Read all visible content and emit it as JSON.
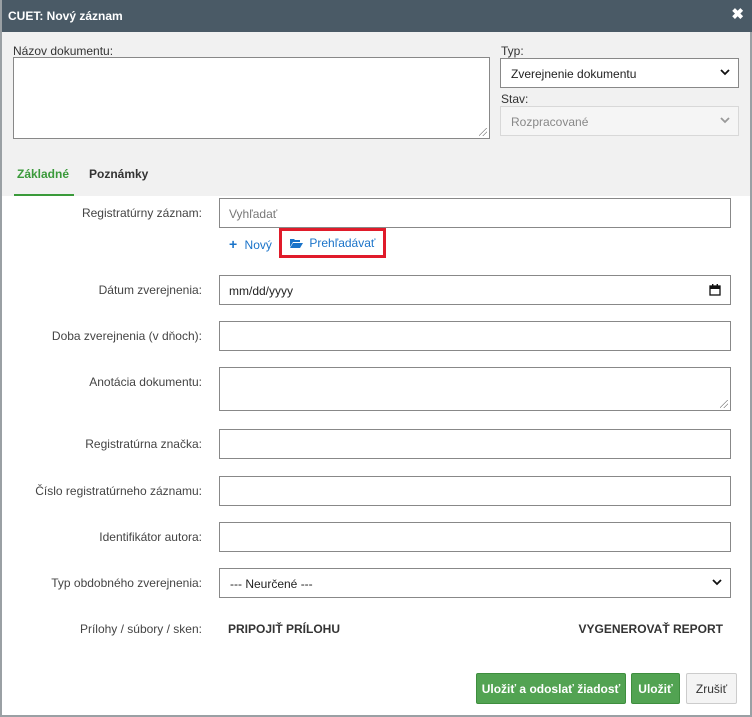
{
  "window": {
    "title": "CUET: Nový záznam",
    "close_icon": "close-icon"
  },
  "header": {
    "name_label": "Názov dokumentu:",
    "name_value": "",
    "type_label": "Typ:",
    "type_value": "Zverejnenie dokumentu",
    "state_label": "Stav:",
    "state_value": "Rozpracované"
  },
  "tabs": [
    {
      "label": "Základné",
      "active": true
    },
    {
      "label": "Poznámky",
      "active": false
    }
  ],
  "form": {
    "registry_label": "Registratúrny záznam:",
    "registry_placeholder": "Vyhľadať",
    "new_link": "Nový",
    "browse_link": "Prehľadávať",
    "date_label": "Dátum zverejnenia:",
    "date_value": "mm/dd/yyyy",
    "duration_label": "Doba zverejnenia (v dňoch):",
    "annotation_label": "Anotácia dokumentu:",
    "mark_label": "Registratúrna značka:",
    "number_label": "Číslo registratúrneho záznamu:",
    "author_label": "Identifikátor autora:",
    "pubtype_label": "Typ obdobného zverejnenia:",
    "pubtype_value": "--- Neurčené ---",
    "attachments_label": "Prílohy / súbory / sken:",
    "attach_action": "PRIPOJIŤ PRÍLOHU",
    "report_action": "VYGENEROVAŤ REPORT"
  },
  "buttons": {
    "save_send": "Uložiť a odoslať žiadosť",
    "save": "Uložiť",
    "cancel": "Zrušiť"
  },
  "colors": {
    "accent": "#3a9a3a",
    "link": "#1a73c9",
    "highlight": "#e01b2a",
    "titlebar": "#4a5a66"
  }
}
